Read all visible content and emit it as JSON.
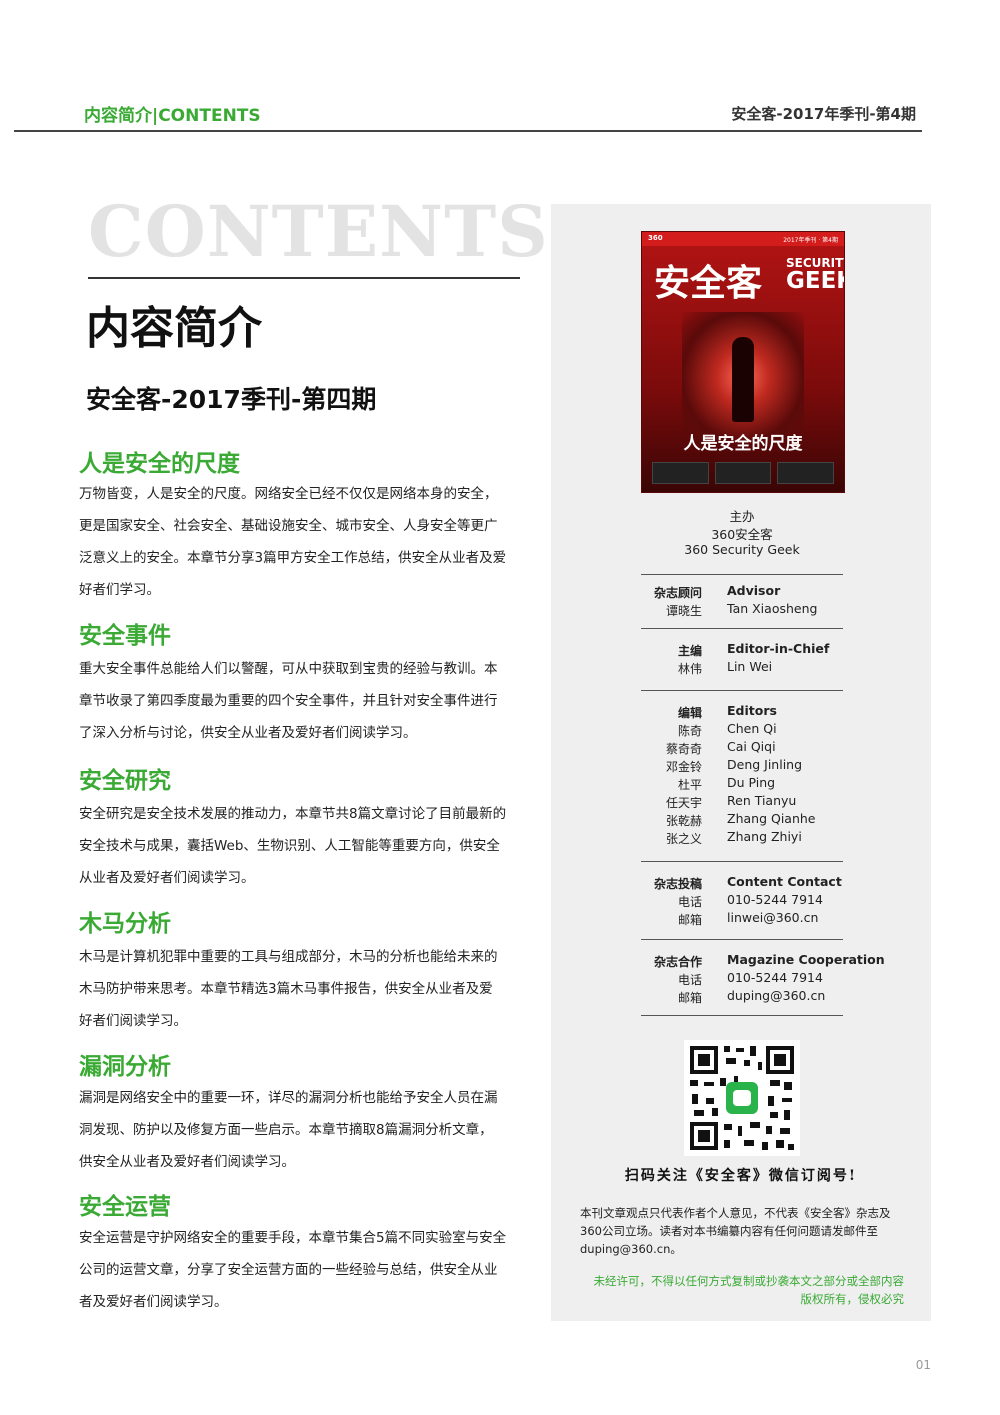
{
  "header": {
    "left": "内容简介|CONTENTS",
    "right": "安全客-2017年季刊-第4期"
  },
  "watermark": "CONTENTS",
  "title": "内容简介",
  "issue_title": "安全客-2017季刊-第四期",
  "sections": [
    {
      "heading": "人是安全的尺度",
      "lines": [
        "万物皆变，人是安全的尺度。网络安全已经不仅仅是网络本身的安全，",
        "更是国家安全、社会安全、基础设施安全、城市安全、人身安全等更广",
        "泛意义上的安全。本章节分享3篇甲方安全工作总结，供安全从业者及爱",
        "好者们学习。"
      ]
    },
    {
      "heading": "安全事件",
      "lines": [
        "重大安全事件总能给人们以警醒，可从中获取到宝贵的经验与教训。本",
        "章节收录了第四季度最为重要的四个安全事件，并且针对安全事件进行",
        "了深入分析与讨论，供安全从业者及爱好者们阅读学习。"
      ]
    },
    {
      "heading": "安全研究",
      "lines": [
        "安全研究是安全技术发展的推动力，本章节共8篇文章讨论了目前最新的",
        "安全技术与成果，囊括Web、生物识别、人工智能等重要方向，供安全",
        "从业者及爱好者们阅读学习。"
      ]
    },
    {
      "heading": "木马分析",
      "lines": [
        "木马是计算机犯罪中重要的工具与组成部分，木马的分析也能给未来的",
        "木马防护带来思考。本章节精选3篇木马事件报告，供安全从业者及爱",
        "好者们阅读学习。"
      ]
    },
    {
      "heading": "漏洞分析",
      "lines": [
        "漏洞是网络安全中的重要一环，详尽的漏洞分析也能给予安全人员在漏",
        "洞发现、防护以及修复方面一些启示。本章节摘取8篇漏洞分析文章，",
        "供安全从业者及爱好者们阅读学习。"
      ]
    },
    {
      "heading": "安全运营",
      "lines": [
        "安全运营是守护网络安全的重要手段，本章节集合5篇不同实验室与安全",
        "公司的运营文章，分享了安全运营方面的一些经验与总结，供安全从业",
        "者及爱好者们阅读学习。"
      ]
    }
  ],
  "cover": {
    "logo": "360",
    "issue": "2017年季刊 · 第4期",
    "cn_title": "安全客",
    "en_title_1": "SECURITY",
    "en_title_2": "GEEK",
    "tagline": "人是安全的尺度"
  },
  "host": {
    "label": "主办",
    "org_cn": "360安全客",
    "org_en": "360 Security Geek"
  },
  "staff": {
    "advisor": {
      "cn_role": "杂志顾问",
      "en_role": "Advisor",
      "names_cn": [
        "谭晓生"
      ],
      "names_en": [
        "Tan Xiaosheng"
      ]
    },
    "chief": {
      "cn_role": "主编",
      "en_role": "Editor-in-Chief",
      "names_cn": [
        "林伟"
      ],
      "names_en": [
        "Lin Wei"
      ]
    },
    "editors": {
      "cn_role": "编辑",
      "en_role": "Editors",
      "names_cn": [
        "陈奇",
        "蔡奇奇",
        "邓金铃",
        "杜平",
        "任天宇",
        "张乾赫",
        "张之义"
      ],
      "names_en": [
        "Chen  Qi",
        "Cai Qiqi",
        "Deng Jinling",
        "Du Ping",
        "Ren Tianyu",
        "Zhang Qianhe",
        "Zhang Zhiyi"
      ]
    },
    "contact": {
      "cn_role": "杂志投稿",
      "en_role": "Content Contact",
      "phone_label": "电话",
      "phone": "010-5244 7914",
      "email_label": "邮箱",
      "email": "linwei@360.cn"
    },
    "cooperation": {
      "cn_role": "杂志合作",
      "en_role": "Magazine Cooperation",
      "phone_label": "电话",
      "phone": "010-5244 7914",
      "email_label": "邮箱",
      "email": "duping@360.cn"
    }
  },
  "qr_caption": "扫码关注《安全客》微信订阅号!",
  "disclaimer": "本刊文章观点只代表作者个人意见，不代表《安全客》杂志及360公司立场。读者对本书编纂内容有任何问题请发邮件至duping@360.cn。",
  "copyright_1": "未经许可，不得以任何方式复制或抄袭本文之部分或全部内容",
  "copyright_2": "版权所有，侵权必究",
  "page_number": "01"
}
